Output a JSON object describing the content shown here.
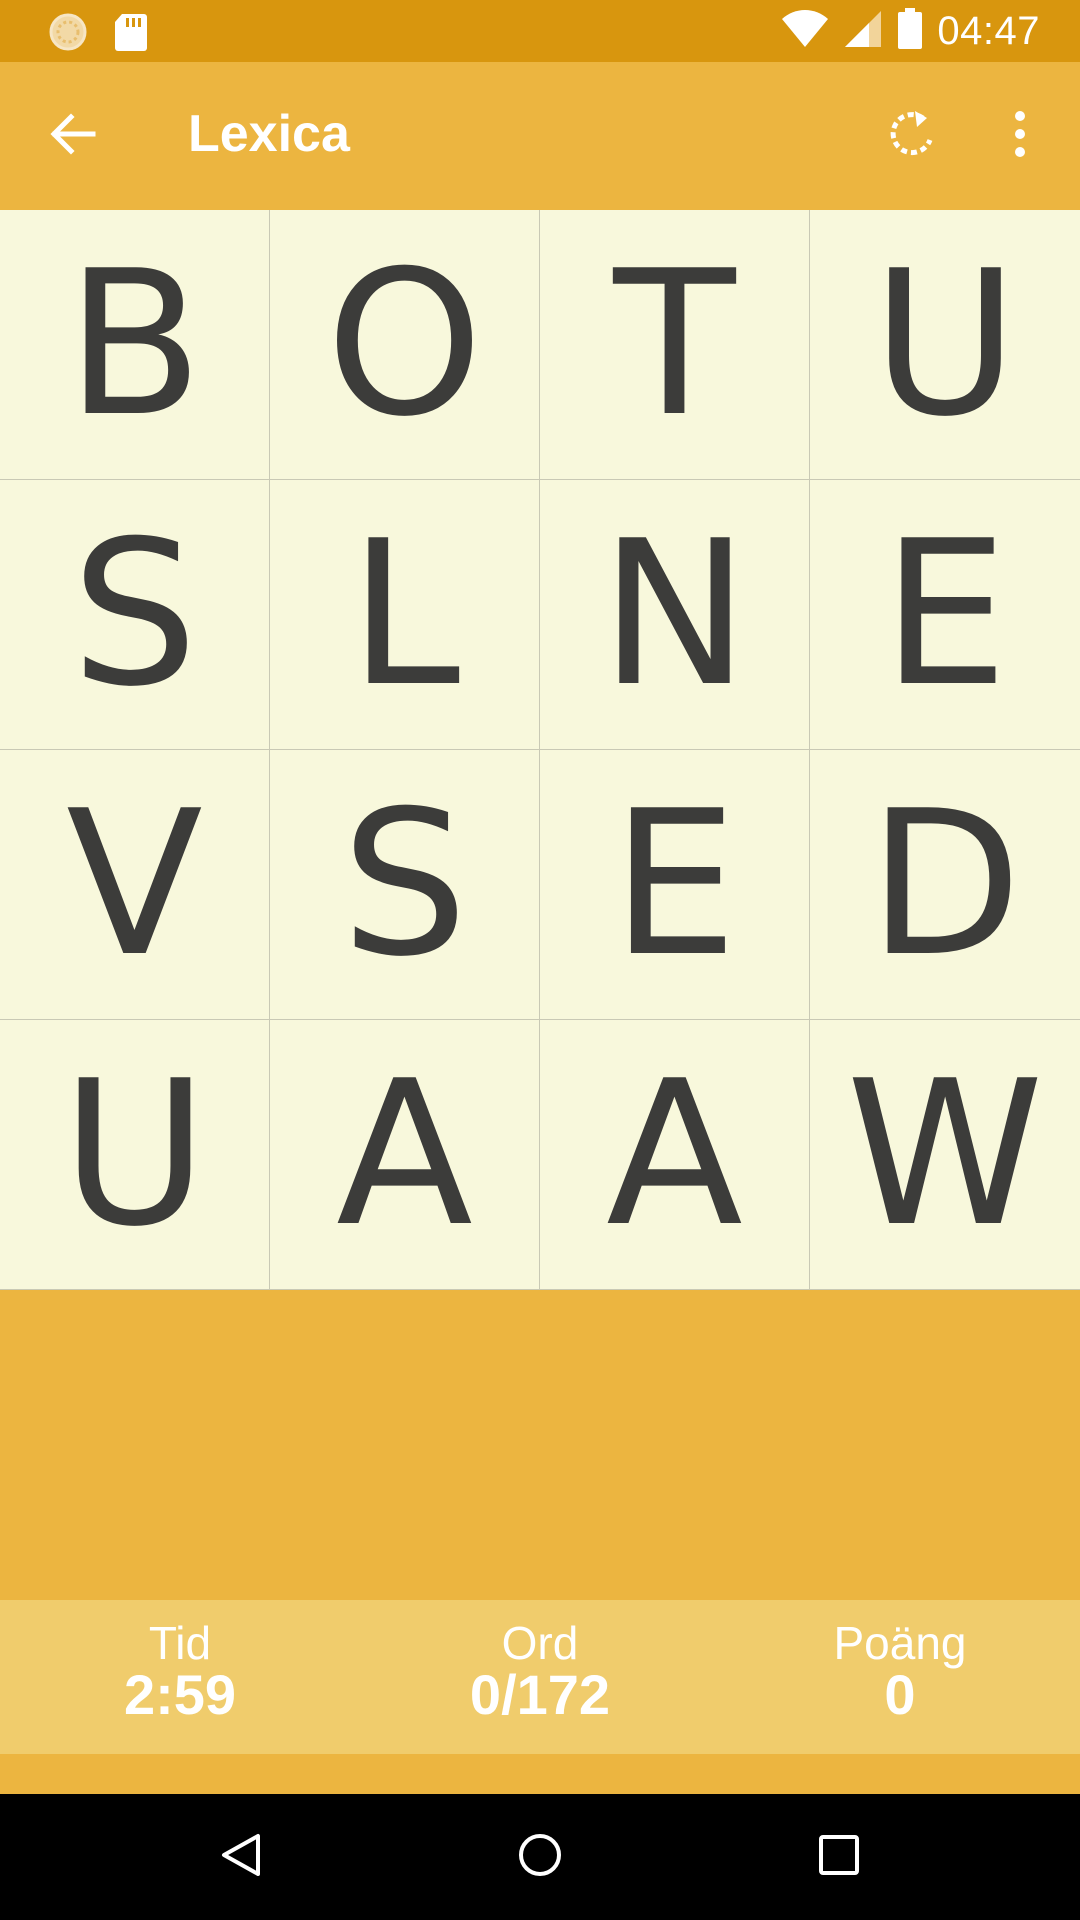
{
  "status_bar": {
    "time": "04:47",
    "left_icons": [
      "sync-icon",
      "sd-card-icon"
    ],
    "right_icons": [
      "wifi-icon",
      "cell-signal-icon",
      "battery-icon"
    ]
  },
  "app_bar": {
    "title": "Lexica",
    "back_icon": "arrow-back-icon",
    "refresh_icon": "refresh-icon",
    "menu_icon": "more-vert-icon"
  },
  "board": {
    "rows": [
      [
        "B",
        "O",
        "T",
        "U"
      ],
      [
        "S",
        "L",
        "N",
        "E"
      ],
      [
        "V",
        "S",
        "E",
        "D"
      ],
      [
        "U",
        "A",
        "A",
        "W"
      ]
    ]
  },
  "stats": {
    "time_label": "Tid",
    "time_value": "2:59",
    "words_label": "Ord",
    "words_value": "0/172",
    "points_label": "Poäng",
    "points_value": "0"
  },
  "nav_bar": {
    "icons": [
      "nav-back-icon",
      "nav-home-icon",
      "nav-recents-icon"
    ]
  },
  "colors": {
    "status_bar": "#D8960E",
    "accent": "#ECB540",
    "board_tile": "#F8F8DC",
    "stats_bar": "#F0CC6C",
    "letter": "#3C3C3A"
  }
}
